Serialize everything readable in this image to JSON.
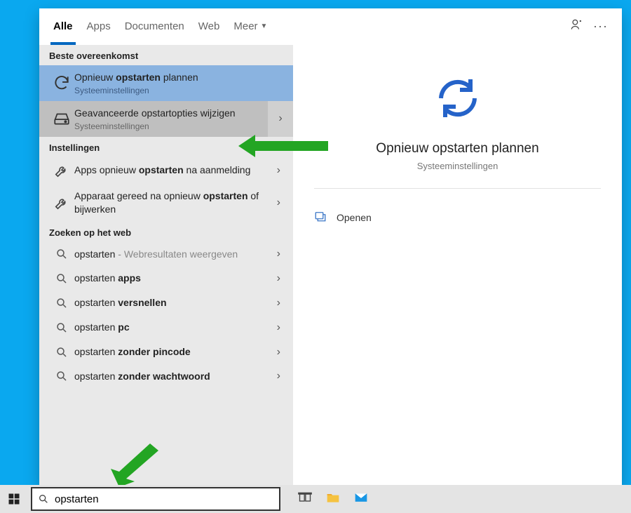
{
  "tabs": {
    "all": "Alle",
    "apps": "Apps",
    "docs": "Documenten",
    "web": "Web",
    "more": "Meer"
  },
  "sections": {
    "best": "Beste overeenkomst",
    "settings": "Instellingen",
    "web": "Zoeken op het web"
  },
  "best_match": {
    "title_pre": "Opnieuw ",
    "title_bold": "opstarten",
    "title_post": " plannen",
    "sub": "Systeeminstellingen"
  },
  "hovered": {
    "title": "Geavanceerde opstartopties wijzigen",
    "sub": "Systeeminstellingen"
  },
  "settings": [
    {
      "pre": "Apps opnieuw ",
      "bold": "opstarten",
      "post": " na aanmelding"
    },
    {
      "pre": "Apparaat gereed na opnieuw ",
      "bold": "opstarten",
      "post": " of bijwerken"
    }
  ],
  "web_results": [
    {
      "term": "opstarten",
      "extra": " - Webresultaten weergeven"
    },
    {
      "pre": "opstarten ",
      "bold": "apps"
    },
    {
      "pre": "opstarten ",
      "bold": "versnellen"
    },
    {
      "pre": "opstarten ",
      "bold": "pc"
    },
    {
      "pre": "opstarten ",
      "bold": "zonder pincode"
    },
    {
      "pre": "opstarten ",
      "bold": "zonder wachtwoord"
    }
  ],
  "preview": {
    "title": "Opnieuw opstarten plannen",
    "sub": "Systeeminstellingen",
    "open": "Openen"
  },
  "search": {
    "value": "opstarten"
  }
}
